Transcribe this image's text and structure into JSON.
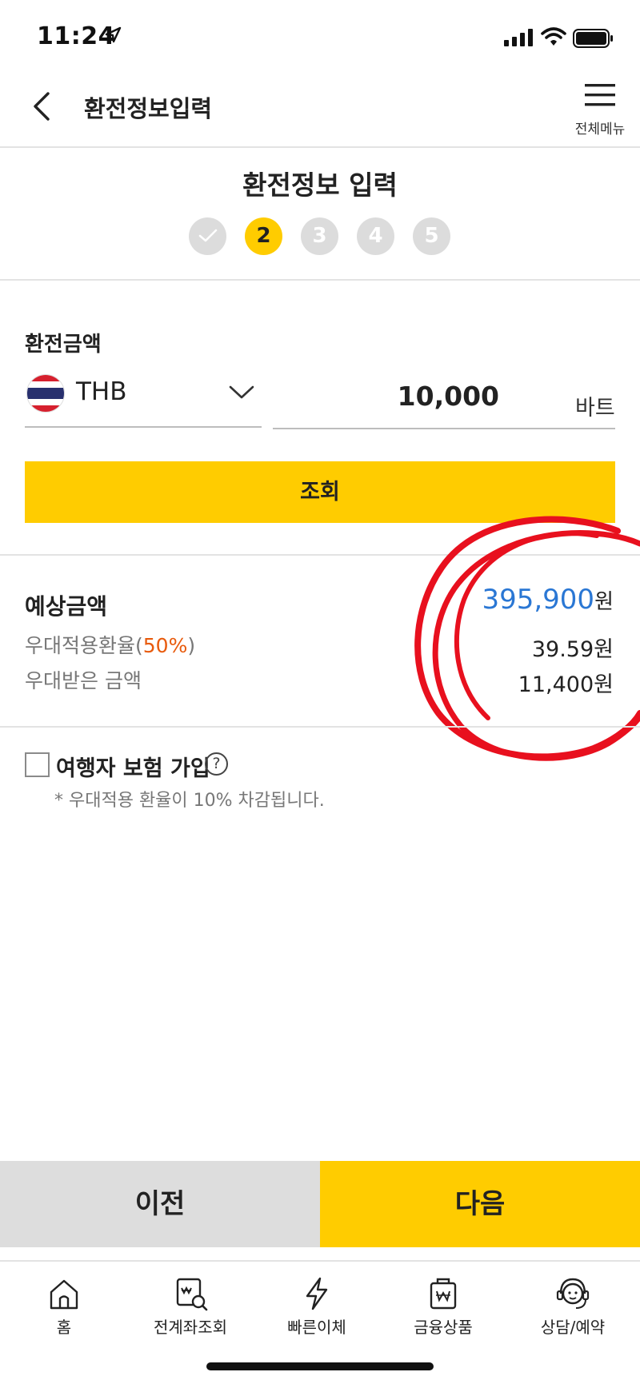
{
  "status_bar": {
    "time": "11:24",
    "icons": [
      "location-arrow-icon",
      "cellular-signal-icon",
      "wifi-icon",
      "battery-icon"
    ]
  },
  "header": {
    "title": "환전정보입력",
    "menu_label": "전체메뉴",
    "icons": [
      "back-arrow-icon",
      "hamburger-menu-icon"
    ]
  },
  "steps": {
    "title": "환전정보 입력",
    "items": [
      {
        "label": "",
        "state": "done",
        "icon": "check-icon"
      },
      {
        "label": "2",
        "state": "active"
      },
      {
        "label": "3",
        "state": "pending"
      },
      {
        "label": "4",
        "state": "pending"
      },
      {
        "label": "5",
        "state": "pending"
      }
    ],
    "current": 2
  },
  "exchange": {
    "label": "환전금액",
    "currency_code": "THB",
    "flag_icon": "thailand-flag-icon",
    "amount": "10,000",
    "unit": "바트",
    "query_button": "조회"
  },
  "result": {
    "estimate_label": "예상금액",
    "estimate_value": "395,900",
    "estimate_unit": "원",
    "rate_label_prefix": "우대적용환율(",
    "rate_percent": "50%",
    "rate_label_suffix": ")",
    "rate_value": "39.59원",
    "discount_label": "우대받은 금액",
    "discount_value": "11,400원"
  },
  "insurance": {
    "label": "여행자 보험 가입",
    "help": "?",
    "note": "* 우대적용 환율이 10% 차감됩니다.",
    "checked": false
  },
  "actions": {
    "prev": "이전",
    "next": "다음"
  },
  "tabbar": {
    "items": [
      {
        "label": "홈",
        "icon": "home-icon"
      },
      {
        "label": "전계좌조회",
        "icon": "account-search-icon"
      },
      {
        "label": "빠른이체",
        "icon": "lightning-icon"
      },
      {
        "label": "금융상품",
        "icon": "won-bag-icon"
      },
      {
        "label": "상담/예약",
        "icon": "headset-agent-icon"
      }
    ]
  },
  "colors": {
    "accent": "#ffcc00",
    "estimate_blue": "#2a77d4",
    "percent_orange": "#e85a0c",
    "annotation_red": "#e8101e"
  }
}
